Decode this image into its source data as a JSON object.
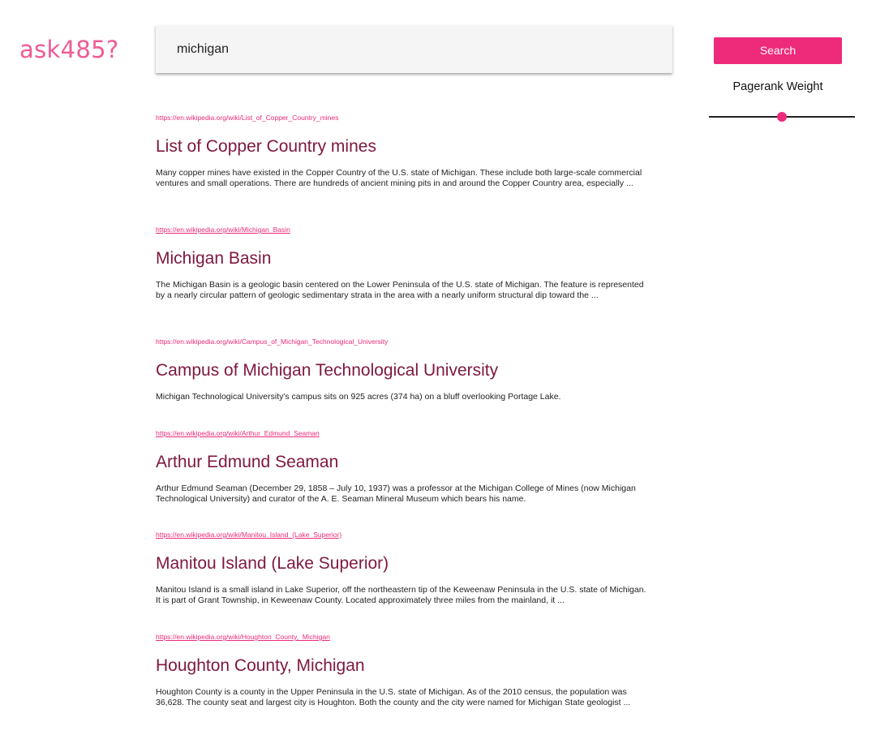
{
  "logo": "ask485?",
  "search": {
    "query": "michigan"
  },
  "search_button": "Search",
  "pagerank": {
    "label": "Pagerank Weight",
    "value": 0.5
  },
  "results": [
    {
      "url": "https://en.wikipedia.org/wiki/List_of_Copper_Country_mines",
      "title": "List of Copper Country mines",
      "snippet": "Many copper mines have existed in the Copper Country of the U.S. state of Michigan. These include both large-scale commercial ventures and small operations. There are hundreds of ancient mining pits in and around the Copper Country area, especially ..."
    },
    {
      "url": "https://en.wikipedia.org/wiki/Michigan_Basin",
      "title": "Michigan Basin",
      "snippet": "The Michigan Basin is a geologic basin centered on the Lower Peninsula of the U.S. state of Michigan. The feature is represented by a nearly circular pattern of geologic sedimentary strata in the area with a nearly uniform structural dip toward the ..."
    },
    {
      "url": "https://en.wikipedia.org/wiki/Campus_of_Michigan_Technological_University",
      "title": "Campus of Michigan Technological University",
      "snippet": "Michigan Technological University's campus sits on 925 acres (374 ha) on a bluff overlooking Portage Lake."
    },
    {
      "url": "https://en.wikipedia.org/wiki/Arthur_Edmund_Seaman",
      "title": "Arthur Edmund Seaman",
      "snippet": "Arthur Edmund Seaman (December 29, 1858 – July 10, 1937) was a professor at the Michigan College of Mines (now Michigan Technological University) and curator of the A. E. Seaman Mineral Museum which bears his name."
    },
    {
      "url": "https://en.wikipedia.org/wiki/Manitou_Island_(Lake_Superior)",
      "title": "Manitou Island (Lake Superior)",
      "snippet": "Manitou Island is a small island in Lake Superior, off the northeastern tip of the Keweenaw Peninsula in the U.S. state of Michigan. It is part of Grant Township, in Keweenaw County. Located approximately three miles from the mainland, it ..."
    },
    {
      "url": "https://en.wikipedia.org/wiki/Houghton_County,_Michigan",
      "title": "Houghton County, Michigan",
      "snippet": "Houghton County is a county in the Upper Peninsula in the U.S. state of Michigan. As of the 2010 census, the population was 36,628. The county seat and largest city is Houghton. Both the county and the city were named for Michigan State geologist ..."
    }
  ]
}
